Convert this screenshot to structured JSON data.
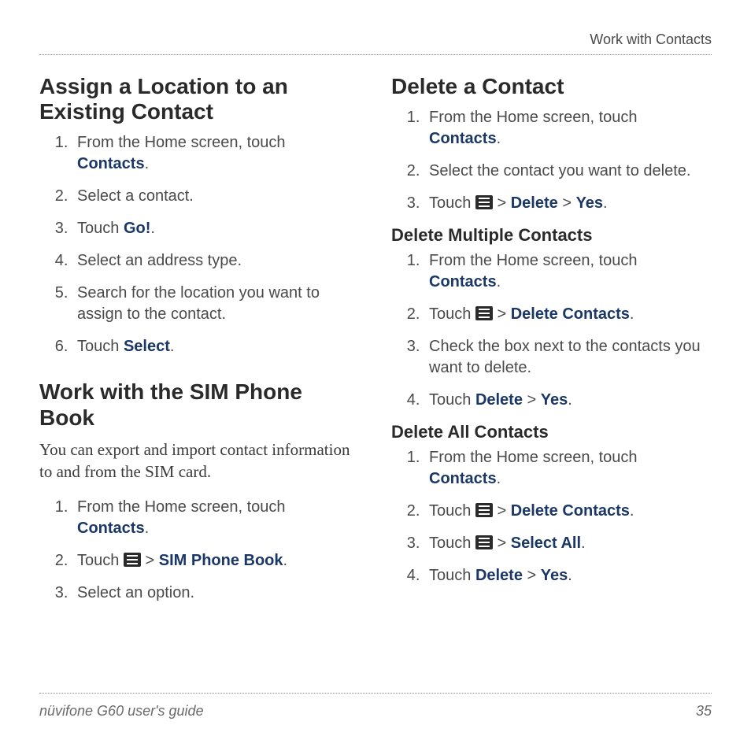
{
  "header": {
    "section_title": "Work with Contacts"
  },
  "left": {
    "sec1": {
      "title": "Assign a Location to an Existing Contact",
      "steps": {
        "s1a": "From the Home screen, touch ",
        "s1b": "Contacts",
        "s1c": ".",
        "s2": "Select a contact.",
        "s3a": "Touch ",
        "s3b": "Go!",
        "s3c": ".",
        "s4": "Select an address type.",
        "s5": "Search for the location you want to assign to the contact.",
        "s6a": "Touch ",
        "s6b": "Select",
        "s6c": "."
      }
    },
    "sec2": {
      "title": "Work with the SIM Phone Book",
      "intro": "You can export and import contact information to and from the SIM card.",
      "steps": {
        "s1a": "From the Home screen, touch ",
        "s1b": "Contacts",
        "s1c": ".",
        "s2a": "Touch ",
        "s2b": " > ",
        "s2c": "SIM Phone Book",
        "s2d": ".",
        "s3": "Select an option."
      }
    }
  },
  "right": {
    "sec1": {
      "title": "Delete a Contact",
      "steps": {
        "s1a": "From the Home screen, touch ",
        "s1b": "Contacts",
        "s1c": ".",
        "s2": "Select the contact you want to delete.",
        "s3a": "Touch ",
        "s3b": " > ",
        "s3c": "Delete",
        "s3d": " > ",
        "s3e": "Yes",
        "s3f": "."
      }
    },
    "sec2": {
      "title": "Delete Multiple Contacts",
      "steps": {
        "s1a": "From the Home screen, touch ",
        "s1b": "Contacts",
        "s1c": ".",
        "s2a": "Touch ",
        "s2b": " > ",
        "s2c": "Delete Contacts",
        "s2d": ".",
        "s3": "Check the box next to the contacts you want to delete.",
        "s4a": "Touch ",
        "s4b": "Delete",
        "s4c": " > ",
        "s4d": "Yes",
        "s4e": "."
      }
    },
    "sec3": {
      "title": "Delete All Contacts",
      "steps": {
        "s1a": "From the Home screen, touch ",
        "s1b": "Contacts",
        "s1c": ".",
        "s2a": "Touch ",
        "s2b": " > ",
        "s2c": "Delete Contacts",
        "s2d": ".",
        "s3a": "Touch ",
        "s3b": " > ",
        "s3c": "Select All",
        "s3d": ".",
        "s4a": "Touch ",
        "s4b": "Delete",
        "s4c": " > ",
        "s4d": "Yes",
        "s4e": "."
      }
    }
  },
  "footer": {
    "guide": "nüvifone G60 user's guide",
    "page": "35"
  }
}
